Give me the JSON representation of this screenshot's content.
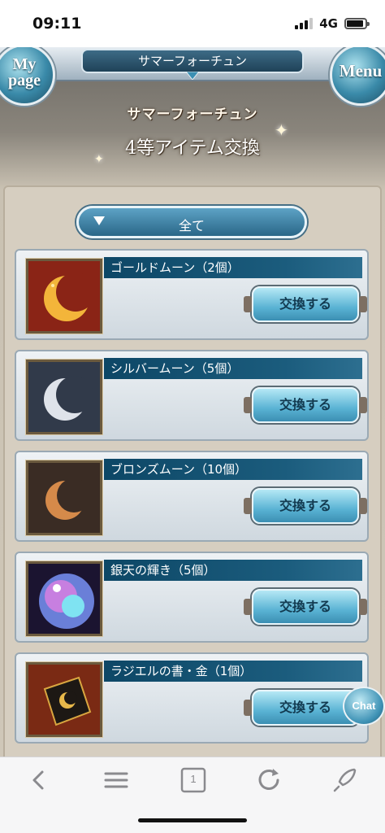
{
  "status_bar": {
    "time": "09:11",
    "network": "4G"
  },
  "header": {
    "event_title": "サマーフォーチュン",
    "mypage_label_line1": "My",
    "mypage_label_line2": "page",
    "menu_label": "Menu"
  },
  "event": {
    "logo_text": "サマーフォーチュン",
    "heading": "4等アイテム交換"
  },
  "filter": {
    "label": "全て"
  },
  "items": [
    {
      "name": "ゴールドムーン（2個）",
      "button": "交換する",
      "icon": "gold-moon-icon"
    },
    {
      "name": "シルバームーン（5個）",
      "button": "交換する",
      "icon": "silver-moon-icon"
    },
    {
      "name": "ブロンズムーン（10個）",
      "button": "交換する",
      "icon": "bronze-moon-icon"
    },
    {
      "name": "銀天の輝き（5個）",
      "button": "交換する",
      "icon": "silver-heaven-orb-icon"
    },
    {
      "name": "ラジエルの書・金（1個）",
      "button": "交換する",
      "icon": "raziel-book-gold-icon"
    }
  ],
  "chat": {
    "label": "Chat"
  },
  "browser_bar": {
    "tab_count": "1"
  },
  "colors": {
    "accent_blue": "#1b5c7d",
    "button_cyan": "#5ab3d4",
    "panel_beige": "#d6cec0"
  }
}
